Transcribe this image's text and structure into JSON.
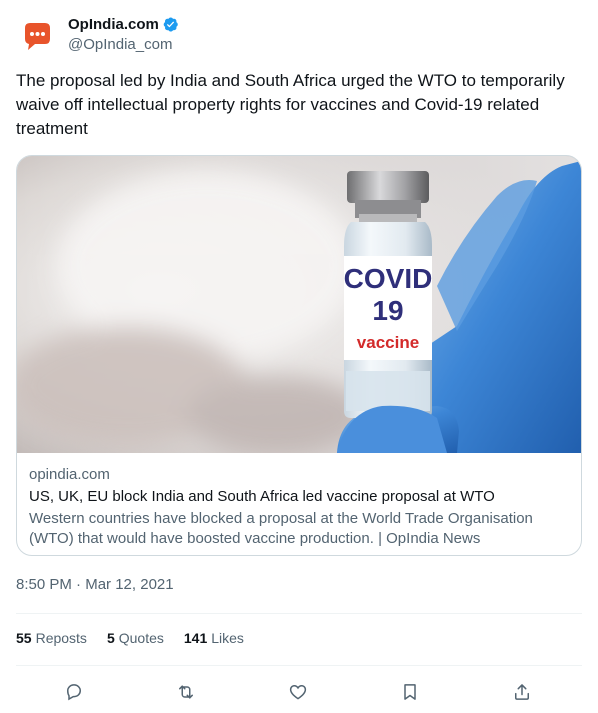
{
  "author": {
    "display_name": "OpIndia.com",
    "handle": "@OpIndia_com",
    "avatar_icon": "speech-bubble-logo-icon",
    "verified_icon": "verified-badge-icon",
    "brand_color": "#e8542b"
  },
  "tweet": {
    "text": "The proposal led by India and South Africa urged the WTO to temporarily waive off intellectual property rights for vaccines and Covid-19 related treatment"
  },
  "card": {
    "domain": "opindia.com",
    "title": "US, UK, EU block India and South Africa led vaccine proposal at WTO",
    "description": "Western countries have blocked a proposal at the World Trade Organisation (WTO) that would have boosted vaccine production. | OpIndia News",
    "image_label_line1": "COVID",
    "image_label_line2": "19",
    "image_label_line3": "vaccine"
  },
  "meta": {
    "time": "8:50 PM",
    "separator": " · ",
    "date": "Mar 12, 2021"
  },
  "stats": {
    "reposts_count": "55",
    "reposts_label": "Reposts",
    "quotes_count": "5",
    "quotes_label": "Quotes",
    "likes_count": "141",
    "likes_label": "Likes"
  },
  "actions": [
    "reply-icon",
    "repost-icon",
    "like-icon",
    "bookmark-icon",
    "share-icon"
  ],
  "colors": {
    "text_primary": "#0f1419",
    "text_secondary": "#536471",
    "verified_blue": "#1d9bf0",
    "border": "#cfd9de"
  }
}
